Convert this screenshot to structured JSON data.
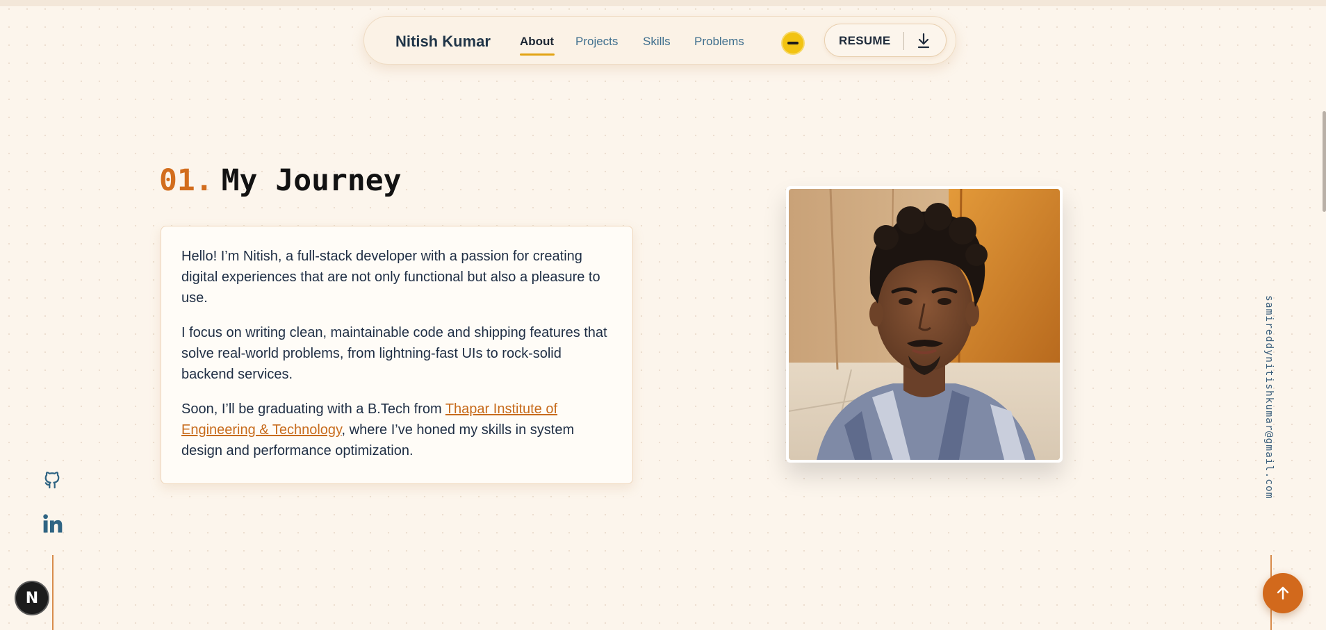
{
  "nav": {
    "brand": "Nitish Kumar",
    "links": [
      {
        "label": "About",
        "active": true
      },
      {
        "label": "Projects",
        "active": false
      },
      {
        "label": "Skills",
        "active": false
      },
      {
        "label": "Problems",
        "active": false
      }
    ],
    "theme_toggle_icon": "theme-toggle-icon",
    "resume_label": "RESUME",
    "resume_icon": "download-icon"
  },
  "section": {
    "number": "01.",
    "title": "My Journey"
  },
  "about": {
    "p1": "Hello! I’m Nitish, a full-stack developer with a passion for creating digital experiences that are not only functional but also a pleasure to use.",
    "p2": "I focus on writing clean, maintainable code and shipping features that solve real-world problems, from lightning-fast UIs to rock-solid backend services.",
    "p3_before": "Soon, I’ll be graduating with a B.Tech from ",
    "p3_link": "Thapar Institute of Engineering & Technology",
    "p3_after": ", where I’ve honed my skills in system design and performance optimization."
  },
  "photo": {
    "subject": "portrait-photo"
  },
  "social": {
    "github_icon": "github-icon",
    "linkedin_icon": "linkedin-icon"
  },
  "email": "samireddynitishkumar@gmail.com",
  "scroll_top_icon": "arrow-up-icon",
  "dev_badge": "N",
  "colors": {
    "accent_orange": "#d26d1d",
    "nav_link": "#3f6f8e",
    "toggle_yellow": "#f2c312",
    "background": "#fcf5ec",
    "text_dark": "#1f2e44"
  }
}
